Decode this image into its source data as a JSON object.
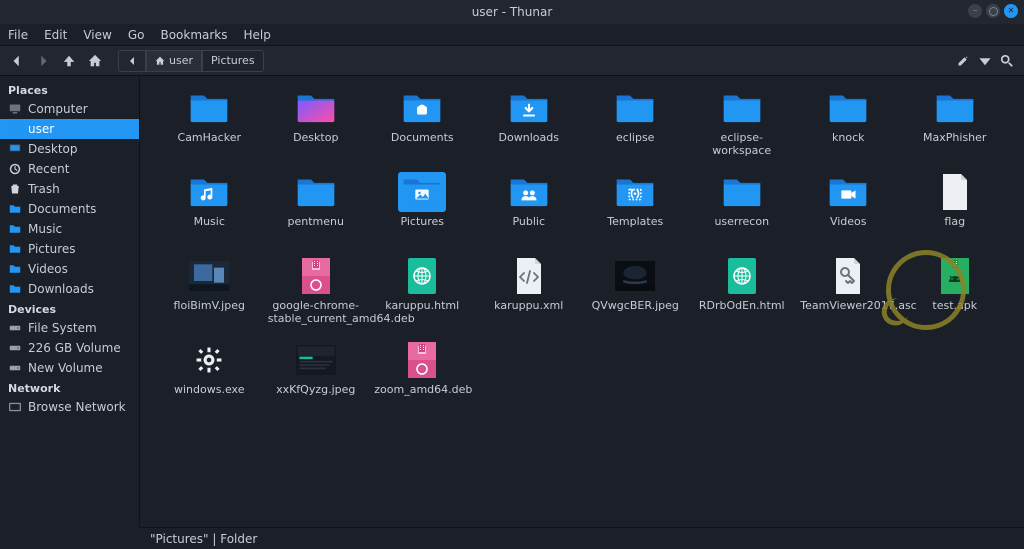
{
  "window": {
    "title": "user - Thunar"
  },
  "menubar": [
    "File",
    "Edit",
    "View",
    "Go",
    "Bookmarks",
    "Help"
  ],
  "path": {
    "current": "user",
    "trail": "Pictures"
  },
  "sidebar": {
    "places_label": "Places",
    "places": [
      {
        "label": "Computer",
        "icon": "computer"
      },
      {
        "label": "user",
        "icon": "folder-blue",
        "selected": true
      },
      {
        "label": "Desktop",
        "icon": "desktop"
      },
      {
        "label": "Recent",
        "icon": "recent"
      },
      {
        "label": "Trash",
        "icon": "trash"
      },
      {
        "label": "Documents",
        "icon": "folder-blue"
      },
      {
        "label": "Music",
        "icon": "folder-blue"
      },
      {
        "label": "Pictures",
        "icon": "folder-blue"
      },
      {
        "label": "Videos",
        "icon": "folder-blue"
      },
      {
        "label": "Downloads",
        "icon": "folder-blue"
      }
    ],
    "devices_label": "Devices",
    "devices": [
      {
        "label": "File System",
        "icon": "drive"
      },
      {
        "label": "226 GB Volume",
        "icon": "drive"
      },
      {
        "label": "New Volume",
        "icon": "drive"
      }
    ],
    "network_label": "Network",
    "network": [
      {
        "label": "Browse Network",
        "icon": "network"
      }
    ]
  },
  "items": [
    {
      "label": "CamHacker",
      "type": "folder"
    },
    {
      "label": "Desktop",
      "type": "folder-gradient"
    },
    {
      "label": "Documents",
      "type": "folder-docs"
    },
    {
      "label": "Downloads",
      "type": "folder-download"
    },
    {
      "label": "eclipse",
      "type": "folder"
    },
    {
      "label": "eclipse-workspace",
      "type": "folder"
    },
    {
      "label": "knock",
      "type": "folder"
    },
    {
      "label": "MaxPhisher",
      "type": "folder"
    },
    {
      "label": "Music",
      "type": "folder-music"
    },
    {
      "label": "pentmenu",
      "type": "folder"
    },
    {
      "label": "Pictures",
      "type": "folder-pics",
      "selected": true
    },
    {
      "label": "Public",
      "type": "folder-public"
    },
    {
      "label": "Templates",
      "type": "folder-templates"
    },
    {
      "label": "userrecon",
      "type": "folder"
    },
    {
      "label": "Videos",
      "type": "folder-videos"
    },
    {
      "label": "flag",
      "type": "file-blank"
    },
    {
      "label": "floiBimV.jpeg",
      "type": "image-thumb1"
    },
    {
      "label": "google-chrome-stable_current_amd64.deb",
      "type": "deb"
    },
    {
      "label": "karuppu.html",
      "type": "html"
    },
    {
      "label": "karuppu.xml",
      "type": "xml"
    },
    {
      "label": "QVwgcBER.jpeg",
      "type": "image-thumb2"
    },
    {
      "label": "RDrbOdEn.html",
      "type": "html"
    },
    {
      "label": "TeamViewer2017.asc",
      "type": "key"
    },
    {
      "label": "test.apk",
      "type": "apk"
    },
    {
      "label": "windows.exe",
      "type": "gear"
    },
    {
      "label": "xxKfQyzg.jpeg",
      "type": "image-thumb3"
    },
    {
      "label": "zoom_amd64.deb",
      "type": "deb"
    }
  ],
  "status": "\"Pictures\" | Folder"
}
